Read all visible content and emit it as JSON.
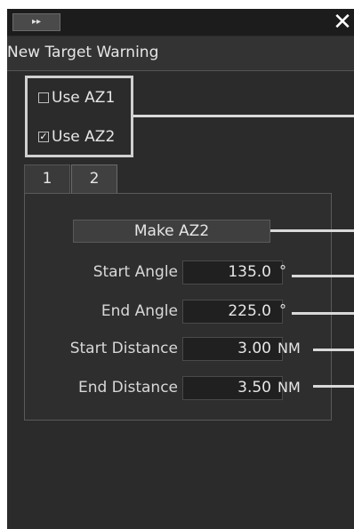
{
  "titlebar": {
    "expand_icon": "▸▸",
    "close_icon": "✕"
  },
  "header": {
    "title": "New Target Warning"
  },
  "az": {
    "az1_label": "Use AZ1",
    "az1_checked": false,
    "az2_label": "Use AZ2",
    "az2_checked": true
  },
  "tabs": [
    {
      "label": "1"
    },
    {
      "label": "2"
    }
  ],
  "main": {
    "make_button_label": "Make AZ2",
    "fields": [
      {
        "label": "Start Angle",
        "value": "135.0",
        "unit": "°"
      },
      {
        "label": "End Angle",
        "value": "225.0",
        "unit": "°"
      },
      {
        "label": "Start Distance",
        "value": "3.00",
        "unit": "NM"
      },
      {
        "label": "End Distance",
        "value": "3.50",
        "unit": "NM"
      }
    ]
  }
}
